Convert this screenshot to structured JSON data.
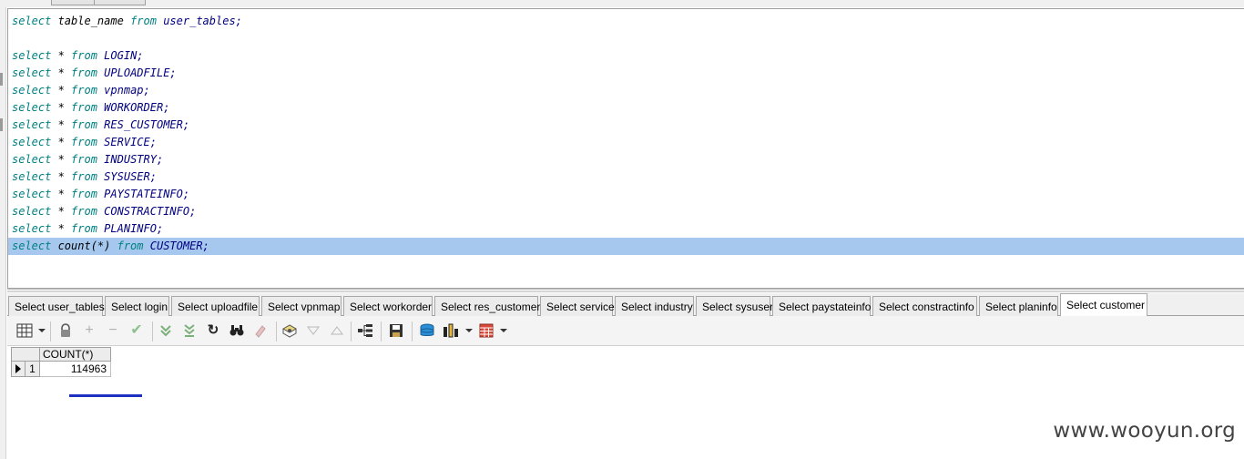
{
  "editor": {
    "lines": [
      {
        "kw1": "select",
        "mid": " table_name ",
        "kw2": "from",
        "tbl": " user_tables;"
      },
      {
        "kw1": "",
        "mid": "",
        "kw2": "",
        "tbl": ""
      },
      {
        "kw1": "select",
        "mid": " * ",
        "kw2": "from",
        "tbl": " LOGIN;"
      },
      {
        "kw1": "select",
        "mid": " * ",
        "kw2": "from",
        "tbl": " UPLOADFILE;"
      },
      {
        "kw1": "select",
        "mid": " * ",
        "kw2": "from",
        "tbl": " vpnmap;"
      },
      {
        "kw1": "select",
        "mid": " * ",
        "kw2": "from",
        "tbl": " WORKORDER;"
      },
      {
        "kw1": "select",
        "mid": " * ",
        "kw2": "from",
        "tbl": " RES_CUSTOMER;"
      },
      {
        "kw1": "select",
        "mid": " * ",
        "kw2": "from",
        "tbl": " SERVICE;"
      },
      {
        "kw1": "select",
        "mid": " * ",
        "kw2": "from",
        "tbl": " INDUSTRY;"
      },
      {
        "kw1": "select",
        "mid": " * ",
        "kw2": "from",
        "tbl": " SYSUSER;"
      },
      {
        "kw1": "select",
        "mid": " * ",
        "kw2": "from",
        "tbl": " PAYSTATEINFO;"
      },
      {
        "kw1": "select",
        "mid": " * ",
        "kw2": "from",
        "tbl": " CONSTRACTINFO;"
      },
      {
        "kw1": "select",
        "mid": " * ",
        "kw2": "from",
        "tbl": " PLANINFO;"
      },
      {
        "kw1": "select",
        "mid": " count(*) ",
        "kw2": "from",
        "tbl": " CUSTOMER;"
      }
    ],
    "selected_line": 13
  },
  "result_tabs": [
    "Select user_tables",
    "Select login",
    "Select uploadfile",
    "Select vpnmap",
    "Select workorder",
    "Select res_customer",
    "Select service",
    "Select industry",
    "Select sysuser",
    "Select paystateinfo",
    "Select constractinfo",
    "Select planinfo",
    "Select customer"
  ],
  "active_tab": 12,
  "toolbar_icons": [
    "grid-view-icon",
    "lock-icon",
    "add-record-icon",
    "delete-record-icon",
    "post-changes-icon",
    "fetch-next-icon",
    "fetch-all-icon",
    "refresh-icon",
    "find-icon",
    "clear-filter-icon",
    "query-by-example-icon",
    "sort-descending-icon",
    "sort-ascending-icon",
    "tree-view-icon",
    "save-icon",
    "export-icon",
    "chart-icon",
    "table-icon"
  ],
  "grid": {
    "columns": [
      "COUNT(*)"
    ],
    "rows": [
      {
        "num": "1",
        "values": [
          "114963"
        ]
      }
    ]
  },
  "watermark": "www.wooyun.org",
  "colors": {
    "keyword": "#008080",
    "identifier": "#000080",
    "selection": "#a6c8ef",
    "redaction": "#1f2fbf"
  }
}
